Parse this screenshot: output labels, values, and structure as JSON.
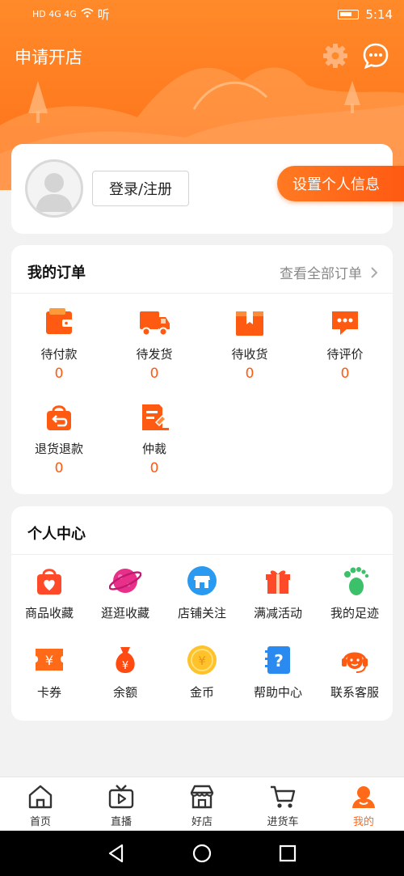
{
  "status_bar": {
    "network_left": "HD 4G 4G",
    "audio_icon": "听",
    "time": "5:14"
  },
  "header": {
    "title": "申请开店",
    "settings_icon": "gear-icon",
    "message_icon": "chat-bubble-icon"
  },
  "profile": {
    "login_label": "登录/注册",
    "set_info_label": "设置个人信息"
  },
  "orders": {
    "title": "我的订单",
    "view_all": "查看全部订单",
    "items": [
      {
        "label": "待付款",
        "count": "0",
        "icon": "wallet-icon"
      },
      {
        "label": "待发货",
        "count": "0",
        "icon": "truck-icon"
      },
      {
        "label": "待收货",
        "count": "0",
        "icon": "box-icon"
      },
      {
        "label": "待评价",
        "count": "0",
        "icon": "comment-icon"
      },
      {
        "label": "退货退款",
        "count": "0",
        "icon": "return-bag-icon"
      },
      {
        "label": "仲裁",
        "count": "0",
        "icon": "arbitration-icon"
      }
    ]
  },
  "personal_center": {
    "title": "个人中心",
    "items": [
      {
        "label": "商品收藏",
        "icon": "heart-bag-icon"
      },
      {
        "label": "逛逛收藏",
        "icon": "planet-icon"
      },
      {
        "label": "店铺关注",
        "icon": "store-icon"
      },
      {
        "label": "满减活动",
        "icon": "gift-icon"
      },
      {
        "label": "我的足迹",
        "icon": "footprint-icon"
      },
      {
        "label": "卡券",
        "icon": "coupon-icon"
      },
      {
        "label": "余额",
        "icon": "money-bag-icon"
      },
      {
        "label": "金币",
        "icon": "coin-icon"
      },
      {
        "label": "帮助中心",
        "icon": "help-book-icon"
      },
      {
        "label": "联系客服",
        "icon": "headset-icon"
      }
    ]
  },
  "tabbar": {
    "items": [
      {
        "label": "首页",
        "icon": "home-icon"
      },
      {
        "label": "直播",
        "icon": "live-tv-icon"
      },
      {
        "label": "好店",
        "icon": "shop-icon"
      },
      {
        "label": "进货车",
        "icon": "cart-icon"
      },
      {
        "label": "我的",
        "icon": "profile-icon",
        "active": true
      }
    ]
  },
  "colors": {
    "brand": "#ff6a18",
    "count": "#ff5a12",
    "background": "#f2f2f2"
  }
}
